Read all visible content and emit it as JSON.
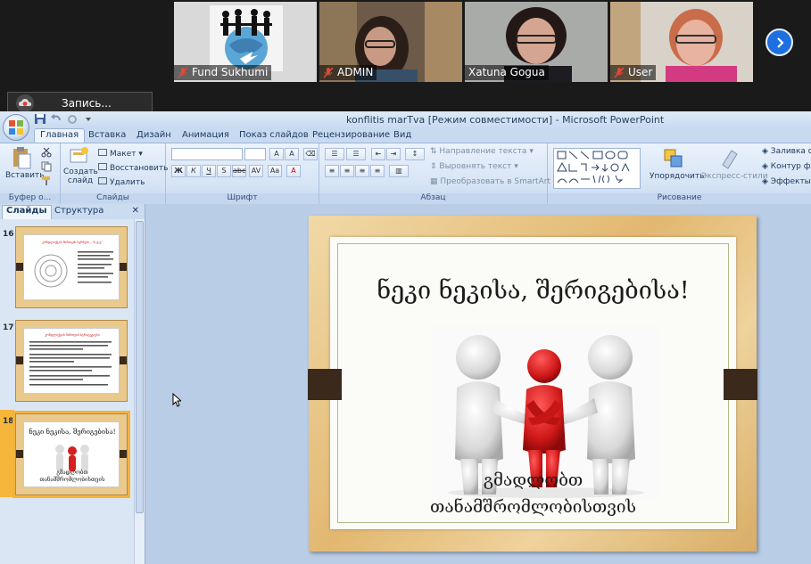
{
  "participants": [
    {
      "name": "Fund Sukhumi",
      "muted": true
    },
    {
      "name": "ADMIN",
      "muted": true
    },
    {
      "name": "Xatuna Gogua",
      "muted": false,
      "active": true
    },
    {
      "name": "User",
      "muted": true
    }
  ],
  "recording": {
    "label": "Запись..."
  },
  "ppt": {
    "window_title": "konflitis marTva [Режим совместимости] - Microsoft PowerPoint",
    "tabs": [
      "Главная",
      "Вставка",
      "Дизайн",
      "Анимация",
      "Показ слайдов",
      "Рецензирование",
      "Вид"
    ],
    "active_tab": "Главная",
    "ribbon": {
      "clipboard": {
        "paste": "Вставить",
        "label": "Буфер о..."
      },
      "slides": {
        "new_slide": "Создать слайд",
        "layout": "Макет",
        "reset": "Восстановить",
        "delete": "Удалить",
        "label": "Слайды"
      },
      "font": {
        "label": "Шрифт"
      },
      "paragraph": {
        "text_direction": "Направление текста",
        "align_text": "Выровнять текст",
        "smartart": "Преобразовать в SmartArt",
        "label": "Абзац"
      },
      "drawing": {
        "arrange": "Упорядочить",
        "quick_styles": "Экспресс-стили",
        "shape_fill": "Заливка ф",
        "shape_outline": "Контур ф",
        "shape_effects": "Эффекты",
        "label": "Рисование"
      }
    },
    "pane_tabs": [
      "Слайды",
      "Структура"
    ],
    "thumbnails": [
      {
        "number": "16",
        "title": "კონფლიქტის მართვის ხერხები - \"ს.ტ.ე\""
      },
      {
        "number": "17",
        "title": "კონფლიქტის მართვის სტრატეგიები"
      },
      {
        "number": "18",
        "title": "ნეკი ნეკისა, შერიგებისა!",
        "caption1": "გმადლობთ",
        "caption2": "თანამშრომლობისთვის",
        "selected": true
      }
    ],
    "slide": {
      "title": "ნეკი ნეკისა, შერიგებისა!",
      "caption1": "გმადლობთ",
      "caption2": "თანამშრომლობისთვის"
    }
  }
}
